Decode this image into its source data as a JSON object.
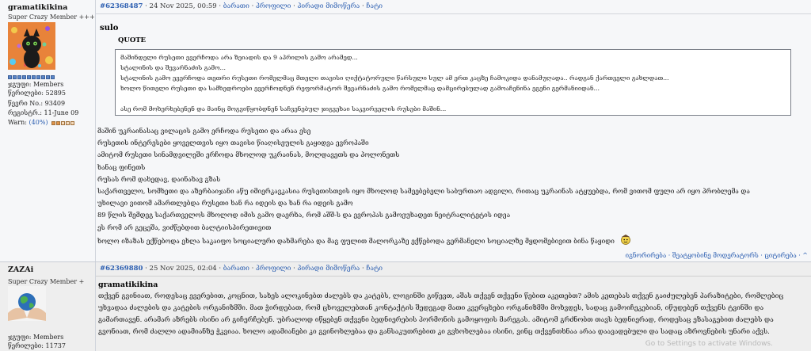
{
  "post1": {
    "username": "gramatikikina",
    "rank": "Super Crazy Member +++",
    "stats": {
      "group": "ჯგუფი: Members",
      "posts": "წერილები: 52895",
      "member_no": "წევრი No.: 93409",
      "joined": "რეგისტრ.: 11-June 09",
      "warn_label": "Warn:",
      "warn_pct": "(40%)",
      "warn_level": 0.4
    },
    "header": {
      "post_id": "#62368487",
      "date": " · 24 Nov 2025, 00:59 · ",
      "link_reply": "ბარათი",
      "sep": " · ",
      "link_profile": "პროფილი",
      "link_pm": "პირადი მიმოწერა",
      "link_chat": "ჩატი"
    },
    "subject": "sulo",
    "quote_label": "QUOTE",
    "quote_lines": [
      "მაშინდელი რუსეთი ევერჩოდა არა ზეიადის და 9 აპრილის გამო არამედ...",
      "სტალინის და შევარნაძის გამო...",
      "სტალინის გამო ევერჩოდა თეთრი რუსეთი რომელმაც მთელი თავისი ღიქტატორული წარსული სულ ამ ერთ კაცზე ჩამოკიდა დანამუღადა.. რადგან ქართველი გახლდათ...",
      "ხოლო წითელი რუსეთი და სამხედროები ევერჩოდნენ რეფორმატორ შევარნაძის გამო რომელმაც დამცირებულად გამოაჩენინა ეგენი გერმანიიდან...",
      "",
      "ასე რომ მოხერხებენენ და მაინც მოგვიწყობდნენ საჩვენებულ ჯიგვეხაი საკვირველის რუსები მაშინ..."
    ],
    "body_lines": [
      "მაშინ უკრაინასაც ვილაცის გამო ერჩოდა რუსეთი და არაა ესე",
      "რუსეთის ინტერესები ყოველთვის იყო თავისი წიაღისეულის გაყიდვა ევროპაში",
      "ამიტომ რუსეთი სინამდვილეში ერჩოდა მხოლოდ უკრაინას, მოლდავეთს და პოლონეთს",
      "ხანაც ფინეთს",
      "რუსას რომ დახედავ, დაინახავ გზას",
      "საქართველო, სომხეთი და აზერბაიჯანი აწუ იმიერკავკასია რუსეთისთვის იყო მხოლოდ სამეებებელი საბურთაო ადგილი, რითაც უკრაინას ატყუებდა, რომ ვითომ ფული არ იყო პრობლემა და",
      "უხილავი ვითომ ამართლებდა რუსეთი ხან რა იდეის და ხან რა იდეის გამო",
      "89 წლის შემდეგ საქართველოს მხოლოდ იმის გამო დაერხა, რომ აშშ-ს და ევროპას გამოეუხადეთ ნეიტრალიტეტის იდეა",
      "ეს რომ არ გეცეშა, ვიძწებდით ბალტიისპირეთივით",
      "ხოლო იზაზას ექწებოდა ეხლა საკაიფო სოციალური დახმარება და მაგ ფულით მალორკაზე ექწებოდა გერმანელი სოციალზე მყდომებივით ბინა წაყიდი"
    ],
    "footer": {
      "ignore": "იგნორირება",
      "sep1": " · ",
      "report": "შეატყობინე მოდერატორს",
      "sep2": " · ",
      "quote": "ციტირება",
      "sep3": " · ",
      "up": "^"
    }
  },
  "post2": {
    "username": "ZAZAi",
    "rank": "Super Crazy Member +",
    "stats": {
      "group": "ჯგუფი: Members",
      "posts": "წერილები: 11737"
    },
    "header": {
      "post_id": "#62369880",
      "date": " · 25 Nov 2025, 02:04 · ",
      "link_reply": "ბარათი",
      "sep": " · ",
      "link_profile": "პროფილი",
      "link_pm": "პირადი მიმოწერა",
      "link_chat": "ჩატი"
    },
    "quoted_user": "gramatikikina",
    "body": "თქვენ გვინიათ, როდესაც ევერებით, კოცნით, სახეს ალოკინებთ ძალებს და კატებს, ლოგინში გიწევთ, აშას თქვენ თქვენი წებით აკეთებთ? ამის კეთებას თქვენ გაიძულებენ პარაზიტები, რომლებიც უხვადაა ძალების და კატების ორგანიზმში. მათ ჭირდებათ, რომ ცხოველებთან კონტაქტის შედეგად მათი კვერცხები ორგანიზმში მოხვდეს, სადაც გამოიჩეკებიან, იწუდებენ თქვენს ტვინში და გამართავენ. არამარ აზრებს ისინი არ გიჩერჩებენ. უბრალოდ იწყებენ თქვენი ბედნიერების ჰორმონის გამოყოფის მარეგას. ამიტომ გრძნობთ თავს ბედნიერად, როდესაც ეზასაგებით ძალებს და გვონიათ, რომ ძალლი ადამიანზე ჭკვიაა. ხოლო ადამიანები კი გვინოხლებაა და განსაკუთრებით კი გვხოხლებაა ისინი, ვინც თქვენთხნაა არაა დაავადებული და სადაც აზროვნების უნარი აქვს.",
    "watermark": "Go to Settings to activate Windows."
  }
}
